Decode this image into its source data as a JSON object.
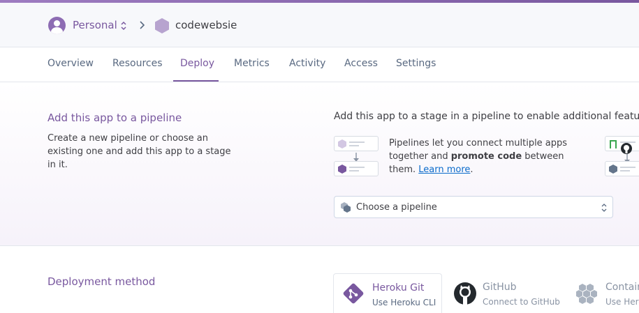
{
  "colors": {
    "brand": "#79589f",
    "accent_bar": "#9e7cc1",
    "link": "#0a6bcb",
    "text": "#3f3f44",
    "muted": "#596981"
  },
  "header": {
    "account_name": "Personal",
    "account_icon": "user-avatar-icon",
    "switch_icon": "chevron-up-down-icon",
    "separator_icon": "chevron-right-icon",
    "app_icon": "hexagon-app-icon",
    "app_name": "codewebsie"
  },
  "tabs": [
    {
      "label": "Overview",
      "active": false
    },
    {
      "label": "Resources",
      "active": false
    },
    {
      "label": "Deploy",
      "active": true
    },
    {
      "label": "Metrics",
      "active": false
    },
    {
      "label": "Activity",
      "active": false
    },
    {
      "label": "Access",
      "active": false
    },
    {
      "label": "Settings",
      "active": false
    }
  ],
  "pipeline": {
    "title": "Add this app to a pipeline",
    "description": "Create a new pipeline or choose an existing one and add this app to a stage in it.",
    "stage_heading": "Add this app to a stage in a pipeline to enable additional features",
    "info_text_1": "Pipelines let you connect multiple apps together and ",
    "info_bold": "promote code",
    "info_text_2": " between them. ",
    "learn_more": "Learn more",
    "learn_more_suffix": ".",
    "select_placeholder": "Choose a pipeline",
    "select_icon": "pipeline-cubes-icon",
    "select_chevron": "chevron-up-down-icon"
  },
  "deployment": {
    "title": "Deployment method",
    "methods": [
      {
        "title": "Heroku Git",
        "subtitle": "Use Heroku CLI",
        "icon": "git-icon",
        "active": true
      },
      {
        "title": "GitHub",
        "subtitle": "Connect to GitHub",
        "icon": "github-icon",
        "active": false
      },
      {
        "title": "Contain",
        "subtitle": "Use Hero",
        "icon": "container-registry-icon",
        "active": false
      }
    ]
  }
}
